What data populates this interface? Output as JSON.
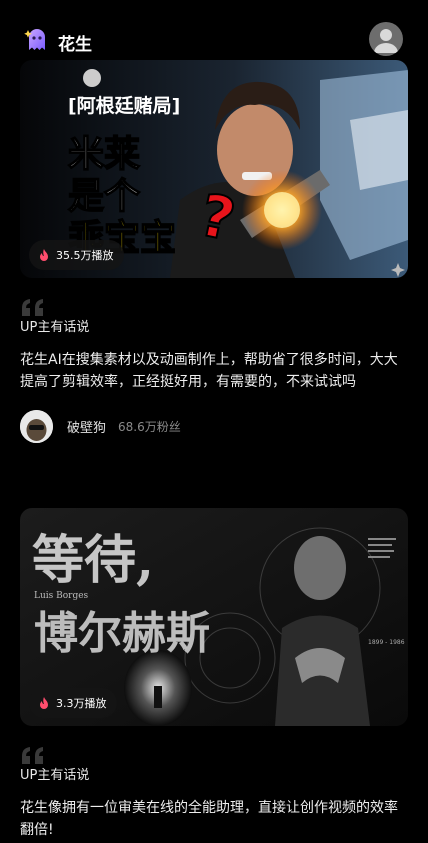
{
  "app": {
    "name": "花生",
    "logo_icon": "ghost-logo-icon",
    "profile_icon": "user-avatar-icon"
  },
  "cards": [
    {
      "thumb_title": "[阿根廷赌局]",
      "thumb_line1": "米莱",
      "thumb_line2": "是个",
      "thumb_line3": "乖宝宝",
      "thumb_question": "?",
      "plays": "35.5万播放",
      "section_label": "UP主有话说",
      "text": "花生AI在搜集素材以及动画制作上，帮助省了很多时间，大大提高了剪辑效率，正经挺好用，有需要的，不来试试吗",
      "author": "破壁狗",
      "fans": "68.6万粉丝"
    },
    {
      "thumb_line1": "等待,",
      "thumb_line2": "博尔赫斯",
      "thumb_caption_left": "Luis Borges",
      "thumb_years": "1899 - 1986",
      "plays": "3.3万播放",
      "section_label": "UP主有话说",
      "text": "花生像拥有一位审美在线的全能助理，直接让创作视频的效率翻倍!"
    }
  ],
  "colors": {
    "accent_flame": "#ff4d6d",
    "yellow_text": "#ffe100",
    "red_question": "#e8141b"
  }
}
